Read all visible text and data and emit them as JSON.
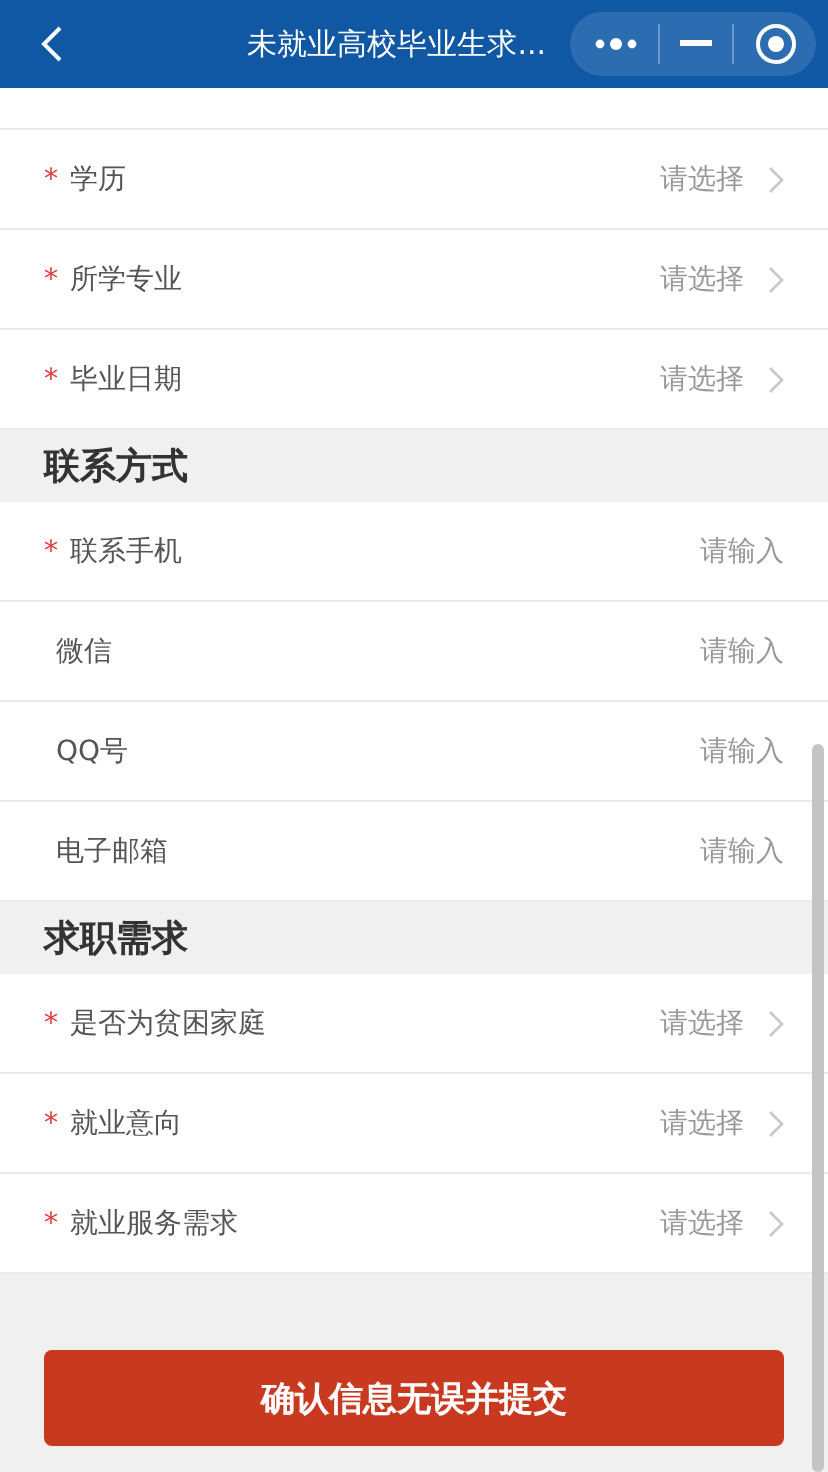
{
  "nav_bar": {
    "title": "未就业高校毕业生求..."
  },
  "sections": [
    {
      "rows": [
        {
          "label": "学历",
          "kind": "select",
          "required": true,
          "placeholder": "请选择"
        },
        {
          "label": "所学专业",
          "kind": "select",
          "required": true,
          "placeholder": "请选择"
        },
        {
          "label": "毕业日期",
          "kind": "select",
          "required": true,
          "placeholder": "请选择"
        }
      ]
    },
    {
      "title": "联系方式",
      "rows": [
        {
          "label": "联系手机",
          "kind": "input",
          "required": true,
          "placeholder": "请输入"
        },
        {
          "label": "微信",
          "kind": "input",
          "required": false,
          "placeholder": "请输入"
        },
        {
          "label": "QQ号",
          "kind": "input",
          "required": false,
          "placeholder": "请输入"
        },
        {
          "label": "电子邮箱",
          "kind": "input",
          "required": false,
          "placeholder": "请输入"
        }
      ]
    },
    {
      "title": "求职需求",
      "rows": [
        {
          "label": "是否为贫困家庭",
          "kind": "select",
          "required": true,
          "placeholder": "请选择"
        },
        {
          "label": "就业意向",
          "kind": "select",
          "required": true,
          "placeholder": "请选择"
        },
        {
          "label": "就业服务需求",
          "kind": "select",
          "required": true,
          "placeholder": "请选择"
        }
      ]
    }
  ],
  "required_mark": "*",
  "submit_button": "确认信息无误并提交"
}
